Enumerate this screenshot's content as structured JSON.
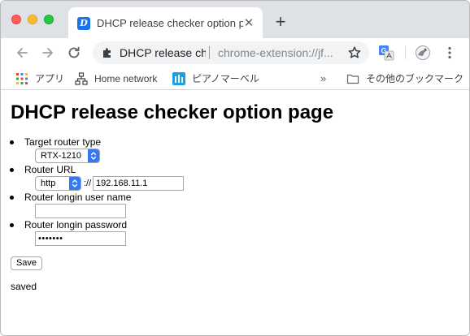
{
  "tab": {
    "title": "DHCP release checker option page",
    "favicon_letter": "D",
    "close_glyph": "✕"
  },
  "new_tab_glyph": "+",
  "omnibox": {
    "site_label": "DHCP release ch",
    "url": "chrome-extension://jf..."
  },
  "bookmarks": {
    "items": [
      {
        "label": "アプリ",
        "icon": "apps-grid-icon"
      },
      {
        "label": "Home network",
        "icon": "network-icon"
      },
      {
        "label": "ピアノマーベル",
        "icon": "piano-marvel-icon"
      }
    ],
    "overflow_glyph": "»",
    "other_folder": "その他のブックマーク"
  },
  "page": {
    "title": "DHCP release checker option page",
    "router_type": {
      "label": "Target router type",
      "selected": "RTX-1210"
    },
    "router_url": {
      "label": "Router URL",
      "protocol": "http",
      "separator": "://",
      "host": "192.168.11.1"
    },
    "username": {
      "label": "Router longin user name",
      "value": ""
    },
    "password": {
      "label": "Router longin password",
      "value": "•••••••"
    },
    "save_label": "Save",
    "status": "saved"
  },
  "colors": {
    "tabstrip": "#dee1e6",
    "accent": "#1a73e8",
    "select_arrow": "#3478f6"
  }
}
